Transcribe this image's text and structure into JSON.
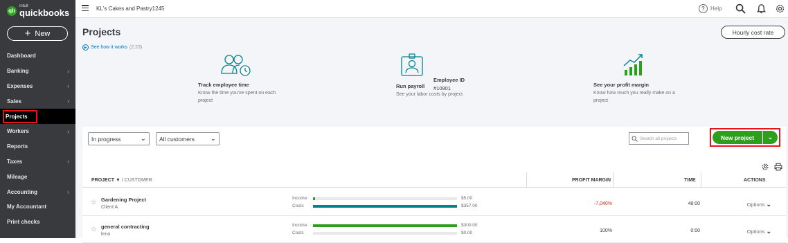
{
  "brand": {
    "logo_intuit": "intuit",
    "logo_name": "quickbooks",
    "logo_glyph": "qb"
  },
  "sidebar": {
    "new_button": "New",
    "items": [
      {
        "label": "Dashboard",
        "chevron": false
      },
      {
        "label": "Banking",
        "chevron": true
      },
      {
        "label": "Expenses",
        "chevron": true
      },
      {
        "label": "Sales",
        "chevron": true
      },
      {
        "label": "Projects",
        "chevron": false,
        "active": true
      },
      {
        "label": "Workers",
        "chevron": true
      },
      {
        "label": "Reports",
        "chevron": false
      },
      {
        "label": "Taxes",
        "chevron": true
      },
      {
        "label": "Mileage",
        "chevron": false
      },
      {
        "label": "Accounting",
        "chevron": true
      },
      {
        "label": "My Accountant",
        "chevron": false
      },
      {
        "label": "Print checks",
        "chevron": false
      }
    ]
  },
  "topbar": {
    "company": "KL's Cakes and Pastry1245",
    "help_label": "Help",
    "icons": [
      "menu-icon",
      "help-icon",
      "search-icon",
      "bell-icon",
      "gear-icon"
    ]
  },
  "page": {
    "title": "Projects",
    "hourly_cost_button": "Hourly cost rate"
  },
  "intro": {
    "see_how_link": "See how it works",
    "see_how_duration": "(2:23)",
    "features": [
      {
        "title": "Track employee time",
        "desc": "Know the time you've spent on each project",
        "icon": "employees-clock-icon"
      },
      {
        "title": "Run payroll",
        "desc": "See your labor costs by project",
        "icon": "employee-badge-icon",
        "badge_label": "Employee ID",
        "badge_value": "#10901"
      },
      {
        "title": "See your profit margin",
        "desc": "Know how much you really make on a project",
        "icon": "profit-chart-icon"
      }
    ]
  },
  "filters": {
    "status_selected": "In progress",
    "customer_selected": "All customers",
    "search_placeholder": "Search all projects",
    "new_project_button": "New project"
  },
  "table": {
    "headers": {
      "project": "PROJECT",
      "customer": "/ CUSTOMER",
      "sort_indicator": "▼",
      "profit_margin": "PROFIT MARGIN",
      "time": "TIME",
      "actions": "ACTIONS"
    },
    "income_label": "Income",
    "costs_label": "Costs",
    "options_label": "Options",
    "rows": [
      {
        "project": "Gardening Project",
        "customer": "Client A",
        "income": "$5.00",
        "costs": "$357.00",
        "income_fill": 0.014,
        "costs_fill": 1.0,
        "profit_margin": "-7,040%",
        "time": "48:00",
        "margin_color": "#d52b1e"
      },
      {
        "project": "general contracting",
        "customer": "leno",
        "income": "$300.00",
        "costs": "$0.00",
        "income_fill": 1.0,
        "costs_fill": 0.0,
        "profit_margin": "100%",
        "time": "0:00",
        "margin_color": "#393a3d"
      }
    ]
  },
  "colors": {
    "accent_green": "#2ca01c",
    "teal": "#00838f",
    "highlight_red": "#e8141a",
    "link_blue": "#0077c5"
  }
}
